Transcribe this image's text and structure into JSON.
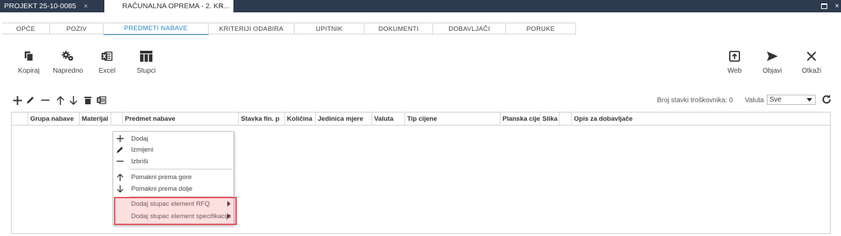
{
  "window": {
    "tabs": [
      {
        "label": "PROJEKT 25-10-0085",
        "close": "×"
      },
      {
        "label": "RAČUNALNA OPREMA - 2. KR...",
        "close": "×"
      }
    ],
    "close_label": "×"
  },
  "tabs": [
    {
      "label": "OPĆE",
      "active": false
    },
    {
      "label": "POZIV",
      "active": false
    },
    {
      "label": "PREDMETI NABAVE",
      "active": true
    },
    {
      "label": "KRITERIJI ODABIRA",
      "active": false
    },
    {
      "label": "UPITNIK",
      "active": false
    },
    {
      "label": "DOKUMENTI",
      "active": false
    },
    {
      "label": "DOBAVLJAČI",
      "active": false
    },
    {
      "label": "PORUKE",
      "active": false
    }
  ],
  "toolbar": {
    "left": [
      {
        "label": "Kopiraj",
        "icon": "copy-icon"
      },
      {
        "label": "Napredno",
        "icon": "gears-icon"
      },
      {
        "label": "Excel",
        "icon": "excel-icon"
      },
      {
        "label": "Stupci",
        "icon": "columns-icon"
      }
    ],
    "right": [
      {
        "label": "Web",
        "icon": "web-export-icon"
      },
      {
        "label": "Objavi",
        "icon": "send-icon"
      },
      {
        "label": "Otkaži",
        "icon": "close-icon"
      }
    ]
  },
  "grid_toolbar": {
    "count_label": "Broj stavki troškovnika: 0",
    "valuta_label": "Valuta",
    "valuta_value": "Sve"
  },
  "grid": {
    "columns": [
      "Grupa nabave",
      "Materijal",
      "",
      "Predmet nabave",
      "Stavka fin. p",
      "Količina",
      "Jedinica mjere",
      "Valuta",
      "Tip cijene",
      "Planska cijena",
      "Slika",
      "",
      "Opis za dobavljače"
    ]
  },
  "context_menu": {
    "items": [
      {
        "label": "Dodaj",
        "icon": "plus-icon"
      },
      {
        "label": "Izmijeni",
        "icon": "pencil-icon"
      },
      {
        "label": "Izbriši",
        "icon": "minus-icon"
      },
      {
        "label": "Pomakni prema gore",
        "icon": "arrow-up-icon"
      },
      {
        "label": "Pomakni prema dolje",
        "icon": "arrow-down-icon"
      },
      {
        "label": "Dodaj stupac element RFQ",
        "icon": "submenu-arrow-icon"
      },
      {
        "label": "Dodaj stupac element specifikacije",
        "icon": "submenu-arrow-icon"
      }
    ]
  },
  "colors": {
    "titlebar": "#2e3b4e",
    "accent": "#2a8bc9",
    "highlight_border": "#e8525a"
  }
}
